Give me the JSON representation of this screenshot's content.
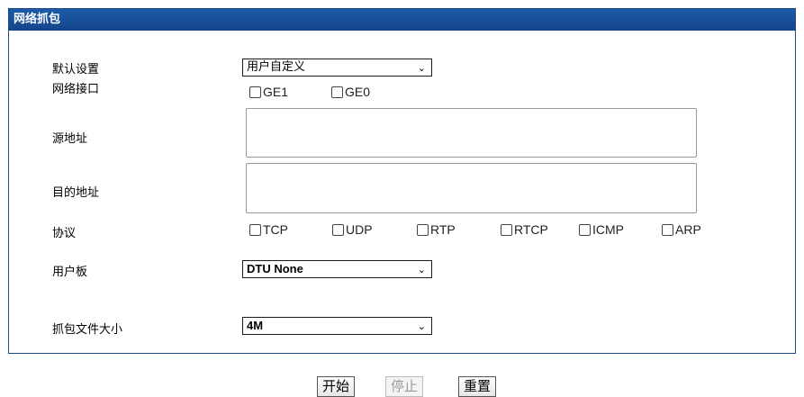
{
  "panel": {
    "title": "网络抓包"
  },
  "form": {
    "default_settings": {
      "label": "默认设置",
      "value": "用户自定义"
    },
    "network_interface": {
      "label": "网络接口",
      "options": [
        "GE1",
        "GE0"
      ]
    },
    "source_address": {
      "label": "源地址",
      "value": ""
    },
    "dest_address": {
      "label": "目的地址",
      "value": ""
    },
    "protocol": {
      "label": "协议",
      "options": [
        "TCP",
        "UDP",
        "RTP",
        "RTCP",
        "ICMP",
        "ARP"
      ]
    },
    "user_board": {
      "label": "用户板",
      "value": "DTU None"
    },
    "capture_size": {
      "label": "抓包文件大小",
      "value": "4M"
    }
  },
  "buttons": {
    "start": "开始",
    "stop": "停止",
    "reset": "重置"
  },
  "icons": {
    "dropdown": "chevron-down-icon"
  }
}
